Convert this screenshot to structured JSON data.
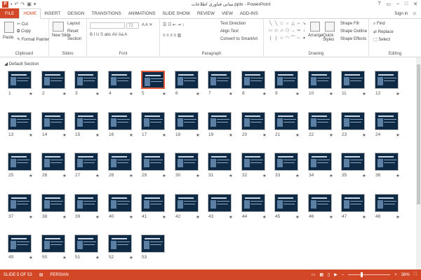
{
  "titlebar": {
    "title": "مبانی فناوری اطلاعات.pptx - PowerPoint",
    "help": "?"
  },
  "tabs": [
    "FILE",
    "HOME",
    "INSERT",
    "DESIGN",
    "TRANSITIONS",
    "ANIMATIONS",
    "SLIDE SHOW",
    "REVIEW",
    "VIEW",
    "ADD-INS"
  ],
  "signin": "Sign in",
  "ribbon": {
    "clipboard": {
      "paste": "Paste",
      "cut": "Cut",
      "copy": "Copy",
      "format_painter": "Format Painter",
      "label": "Clipboard"
    },
    "slides": {
      "new_slide": "New Slide",
      "layout": "Layout",
      "reset": "Reset",
      "section": "Section",
      "label": "Slides"
    },
    "font": {
      "size": "72",
      "label": "Font"
    },
    "paragraph": {
      "text_direction": "Text Direction",
      "align_text": "Align Text",
      "smartart": "Convert to SmartArt",
      "label": "Paragraph"
    },
    "drawing": {
      "arrange": "Arrange",
      "quick_styles": "Quick Styles",
      "shape_fill": "Shape Fill",
      "shape_outline": "Shape Outline",
      "shape_effects": "Shape Effects",
      "label": "Drawing"
    },
    "editing": {
      "find": "Find",
      "replace": "Replace",
      "select": "Select",
      "label": "Editing"
    }
  },
  "section_title": "Default Section",
  "slides": [
    "1",
    "2",
    "3",
    "4",
    "5",
    "6",
    "7",
    "8",
    "9",
    "10",
    "11",
    "12",
    "13",
    "14",
    "15",
    "16",
    "17",
    "18",
    "19",
    "20",
    "21",
    "22",
    "23",
    "24",
    "25",
    "26",
    "27",
    "28",
    "29",
    "30",
    "31",
    "32",
    "33",
    "34",
    "35",
    "36",
    "37",
    "38",
    "39",
    "40",
    "41",
    "42",
    "43",
    "44",
    "45",
    "46",
    "47",
    "48",
    "49",
    "50",
    "51",
    "52",
    "53"
  ],
  "selected_slide": 5,
  "status": {
    "slide_info": "SLIDE 5 OF 53",
    "language": "PERSIAN",
    "zoom": "38%"
  },
  "colors": {
    "accent": "#d24726",
    "slide_bg": "#0f2a44"
  }
}
